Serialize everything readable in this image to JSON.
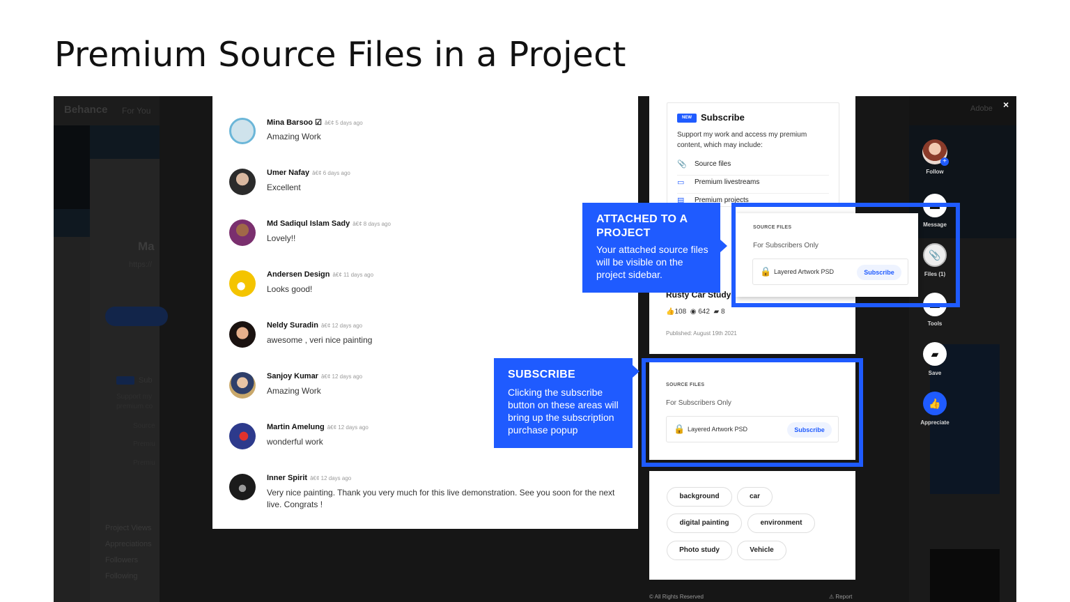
{
  "slide_title": "Premium Source Files in a Project",
  "background_page": {
    "logo": "Behance",
    "nav_for_you": "For You",
    "name_fragment": "Ma",
    "link_fragment": "https://",
    "subscribe_fragment": "Sub",
    "support_fragment_1": "Support my",
    "support_fragment_2": "premium co",
    "source_fragment": "Source",
    "premium_fragment_1": "Premiu",
    "premium_fragment_2": "Premiu",
    "stats": [
      "Project Views",
      "Appreciations",
      "Followers",
      "Following"
    ],
    "adobe": "Adobe"
  },
  "close_symbol": "×",
  "side_actions": [
    {
      "label": "Follow",
      "icon": "avatar"
    },
    {
      "label": "Message",
      "icon": "message-icon"
    },
    {
      "label": "Files (1)",
      "icon": "paperclip-icon"
    },
    {
      "label": "Tools",
      "icon": "tools-icon"
    },
    {
      "label": "Save",
      "icon": "folder-icon"
    },
    {
      "label": "Appreciate",
      "icon": "thumbs-up-icon"
    }
  ],
  "comments": [
    {
      "name": "Mina Barsoo ☑",
      "time": "â€¢ 5 days ago",
      "text": "Amazing Work",
      "color": "#cfe3ec"
    },
    {
      "name": "Umer Nafay",
      "time": "â€¢ 6 days ago",
      "text": "Excellent",
      "color": "#3a3a3a"
    },
    {
      "name": "Md Sadiqul Islam Sady",
      "time": "â€¢ 8 days ago",
      "text": "Lovely!!",
      "color": "#6b4636"
    },
    {
      "name": "Andersen Design",
      "time": "â€¢ 11 days ago",
      "text": "Looks good!",
      "color": "#f4c400"
    },
    {
      "name": "Neldy Suradin",
      "time": "â€¢ 12 days ago",
      "text": "awesome , veri nice painting",
      "color": "#2a1d18"
    },
    {
      "name": "Sanjoy Kumar",
      "time": "â€¢ 12 days ago",
      "text": "Amazing Work",
      "color": "#c9a86b"
    },
    {
      "name": "Martin Amelung",
      "time": "â€¢ 12 days ago",
      "text": "wonderful work",
      "color": "#2d3a8c"
    },
    {
      "name": "Inner Spirit",
      "time": "â€¢ 12 days ago",
      "text": "Very nice painting. Thank you very much for this live demonstration. See you soon for the next live. Congrats !",
      "color": "#1b1b1b"
    }
  ],
  "subscribe_box": {
    "badge": "NEW",
    "title": "Subscribe",
    "description": "Support my work and access my premium content, which may include:",
    "perks": [
      "Source files",
      "Premium livestreams",
      "Premium projects"
    ]
  },
  "project": {
    "title": "Rusty Car Study",
    "appreciations": "108",
    "views": "642",
    "comments": "8",
    "published": "Published: August 19th 2021"
  },
  "source_files": {
    "label": "SOURCE FILES",
    "subtitle": "For Subscribers Only",
    "file_name": "Layered Artwork PSD",
    "button": "Subscribe"
  },
  "tags": [
    "background",
    "car",
    "digital painting",
    "environment",
    "Photo study",
    "Vehicle"
  ],
  "footer": {
    "rights": "© All Rights Reserved",
    "report": "⚠ Report"
  },
  "callouts": {
    "attached": {
      "title_1": "ATTACHED TO A",
      "title_2": "PROJECT",
      "body_1": "Your attached source files",
      "body_2": "will be visible on the",
      "body_3": "project sidebar."
    },
    "subscribe": {
      "title": "SUBSCRIBE",
      "body_1": "Clicking the subscribe",
      "body_2": "button on these areas will",
      "body_3": "bring up the subscription",
      "body_4": "purchase popup"
    }
  },
  "colors": {
    "accent": "#1f5bff",
    "overlay": "#161616"
  }
}
